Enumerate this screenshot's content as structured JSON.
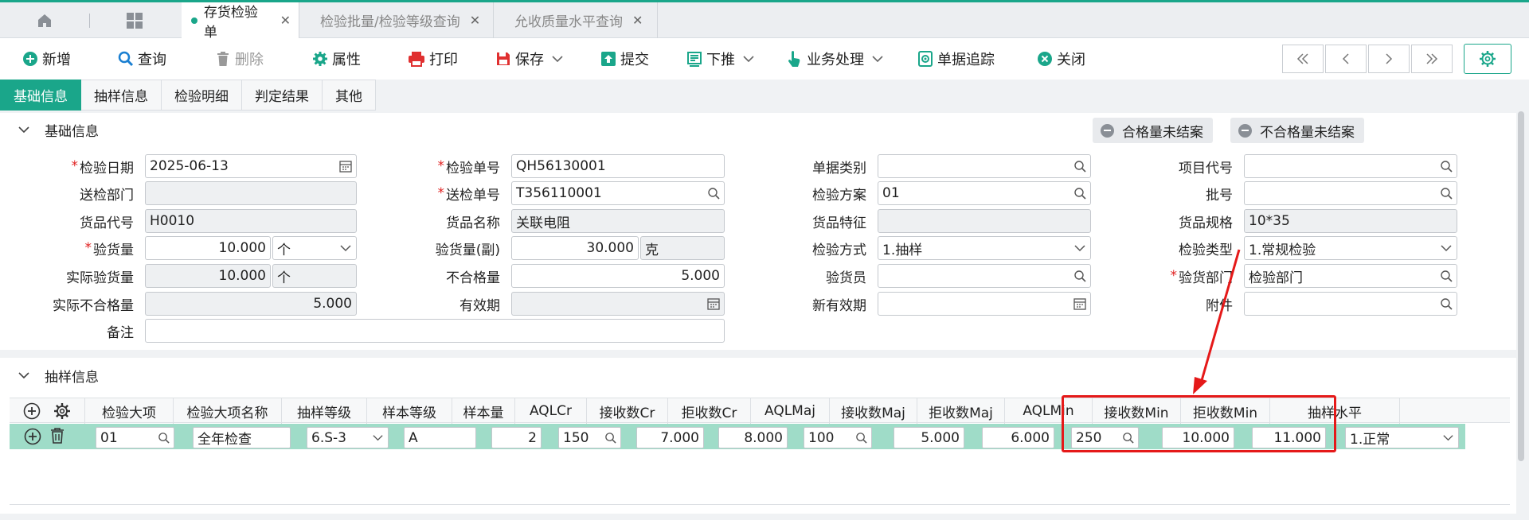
{
  "tabs": [
    {
      "label": "存货检验单",
      "active": true
    },
    {
      "label": "检验批量/检验等级查询",
      "active": false
    },
    {
      "label": "允收质量水平查询",
      "active": false
    }
  ],
  "toolbar": {
    "new": "新增",
    "query": "查询",
    "delete": "删除",
    "props": "属性",
    "print": "打印",
    "save": "保存",
    "submit": "提交",
    "push": "下推",
    "business": "业务处理",
    "trace": "单据追踪",
    "close": "关闭"
  },
  "section_tabs": [
    "基础信息",
    "抽样信息",
    "检验明细",
    "判定结果",
    "其他"
  ],
  "basic": {
    "title": "基础信息",
    "status_pass": "合格量未结案",
    "status_fail": "不合格量未结案",
    "labels": {
      "inspect_date": "检验日期",
      "send_dept": "送检部门",
      "item_code": "货品代号",
      "qty": "验货量",
      "actual_qty": "实际验货量",
      "actual_bad": "实际不合格量",
      "remark": "备注",
      "inspect_no": "检验单号",
      "send_no": "送检单号",
      "item_name": "货品名称",
      "qty_sub": "验货量(副)",
      "bad_qty": "不合格量",
      "expire": "有效期",
      "doc_type": "单据类别",
      "scheme": "检验方案",
      "feature": "货品特征",
      "method": "检验方式",
      "inspector": "验货员",
      "new_expire": "新有效期",
      "project": "项目代号",
      "batch": "批号",
      "spec": "货品规格",
      "type": "检验类型",
      "qc_dept": "验货部门",
      "attach": "附件"
    },
    "values": {
      "inspect_date": "2025-06-13",
      "send_dept": "",
      "item_code": "H0010",
      "qty": "10.000",
      "qty_unit": "个",
      "actual_qty": "10.000",
      "actual_unit": "个",
      "actual_bad": "5.000",
      "remark": "",
      "inspect_no": "QH56130001",
      "send_no": "T356110001",
      "item_name": "关联电阻",
      "qty_sub": "30.000",
      "qty_sub_unit": "克",
      "bad_qty": "5.000",
      "expire": "",
      "doc_type": "",
      "scheme": "01",
      "feature": "",
      "method": "1.抽样",
      "inspector": "",
      "new_expire": "",
      "project": "",
      "batch": "",
      "spec": "10*35",
      "type": "1.常规检验",
      "qc_dept": "检验部门",
      "attach": ""
    }
  },
  "sampling": {
    "title": "抽样信息",
    "columns": [
      "检验大项",
      "检验大项名称",
      "抽样等级",
      "样本等级",
      "样本量",
      "AQLCr",
      "接收数Cr",
      "拒收数Cr",
      "AQLMaj",
      "接收数Maj",
      "拒收数Maj",
      "AQLMin",
      "接收数Min",
      "拒收数Min",
      "抽样水平"
    ],
    "row": [
      "01",
      "全年检查",
      "6.S-3",
      "A",
      "2",
      "150",
      "7.000",
      "8.000",
      "100",
      "5.000",
      "6.000",
      "250",
      "10.000",
      "11.000",
      "1.正常"
    ]
  },
  "colors": {
    "accent": "#1aa68a",
    "highlight": "#e51919",
    "row_selected": "#9fdcc8"
  }
}
